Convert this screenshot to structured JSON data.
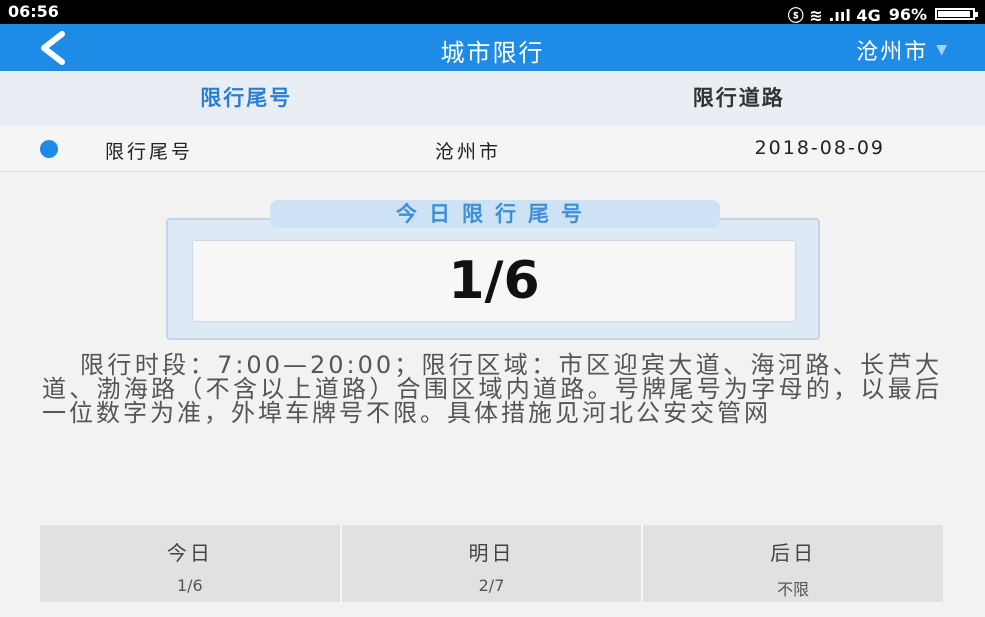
{
  "status_bar": {
    "time": "06:56",
    "indicators": "ⓢ ≋ .ııl 4G",
    "battery": "96%"
  },
  "app_bar": {
    "title": "城市限行",
    "city": "沧州市",
    "back_icon": "chevron-left-icon",
    "dropdown_icon": "chevron-down-icon"
  },
  "tabs": [
    {
      "label": "限行尾号",
      "active": true
    },
    {
      "label": "限行道路",
      "active": false
    }
  ],
  "info": {
    "label": "限行尾号",
    "city": "沧州市",
    "date": "2018-08-09"
  },
  "today_panel": {
    "label": "今日限行尾号",
    "value": "1/6"
  },
  "description": "限行时段：7:00—20:00；限行区域：市区迎宾大道、海河路、长芦大道、渤海路（不含以上道路）合围区域内道路。号牌尾号为字母的，以最后一位数字为准，外埠车牌号不限。具体措施见河北公安交管网",
  "days": [
    {
      "name": "今日",
      "value": "1/6"
    },
    {
      "name": "明日",
      "value": "2/7"
    },
    {
      "name": "后日",
      "value": "不限"
    }
  ],
  "colors": {
    "primary": "#1e8be6",
    "tab_active": "#2a7fd4"
  }
}
